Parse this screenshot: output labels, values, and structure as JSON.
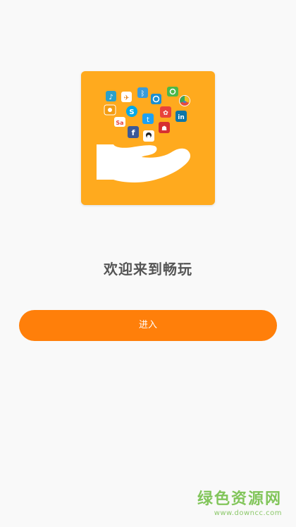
{
  "colors": {
    "background": "#f9f9f9",
    "logo_tile": "#ffaa1e",
    "primary_button": "#ff7f0a",
    "watermark": "#76c04a"
  },
  "logo": {
    "icon": "hand-holding-app-icons-logo",
    "app_icons": [
      "music-icon",
      "flash-icon",
      "bluetooth-icon",
      "camera-icon",
      "message-icon",
      "chrome-icon",
      "weibo-icon",
      "skype-icon",
      "twitter-icon",
      "star-icon",
      "linkedin-icon",
      "sina-icon",
      "facebook-icon",
      "qq-icon",
      "red-app-icon"
    ]
  },
  "welcome": {
    "title": "欢迎来到畅玩"
  },
  "actions": {
    "enter_label": "进入"
  },
  "watermark": {
    "title": "绿色资源网",
    "url": "www.downcc.com"
  }
}
